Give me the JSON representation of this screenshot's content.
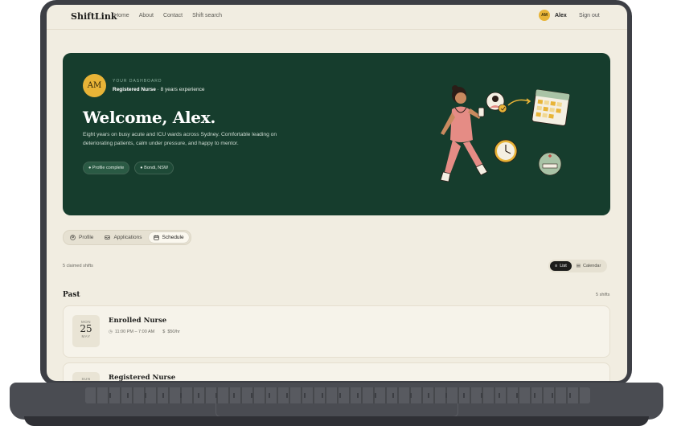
{
  "nav": {
    "logo": "ShiftLink",
    "links": [
      "Home",
      "About",
      "Contact",
      "Shift search"
    ],
    "user_initials": "AM",
    "user_name": "Alex",
    "sign_out": "Sign out"
  },
  "hero": {
    "avatar_initials": "AM",
    "eyebrow": "YOUR DASHBOARD",
    "role": "Registered Nurse",
    "experience": "· 8 years experience",
    "welcome": "Welcome, Alex.",
    "bio": "Eight years on busy acute and ICU wards across Sydney. Comfortable leading on deteriorating patients, calm under pressure, and happy to mentor.",
    "pills": [
      "Profile complete",
      "Bondi, NSW"
    ]
  },
  "tabs": [
    {
      "label": "Profile",
      "icon": "user-icon"
    },
    {
      "label": "Applications",
      "icon": "inbox-icon"
    },
    {
      "label": "Schedule",
      "icon": "calendar-icon",
      "active": true
    }
  ],
  "claimed_text": "5 claimed shifts",
  "view_toggle": {
    "list": "List",
    "calendar": "Calendar",
    "selected": "List"
  },
  "section": {
    "title": "Past",
    "count": "5 shifts"
  },
  "shifts": [
    {
      "dow": "MON",
      "day": "25",
      "month": "MAY",
      "title": "Enrolled Nurse",
      "time": "11:00 PM – 7:00 AM",
      "rate": "$50/hr"
    },
    {
      "dow": "SUN",
      "day": "",
      "month": "",
      "title": "Registered Nurse",
      "time": "",
      "rate": ""
    }
  ],
  "colors": {
    "hero_bg": "#163d2d",
    "accent": "#e8b437",
    "page_bg": "#f1ede1"
  }
}
